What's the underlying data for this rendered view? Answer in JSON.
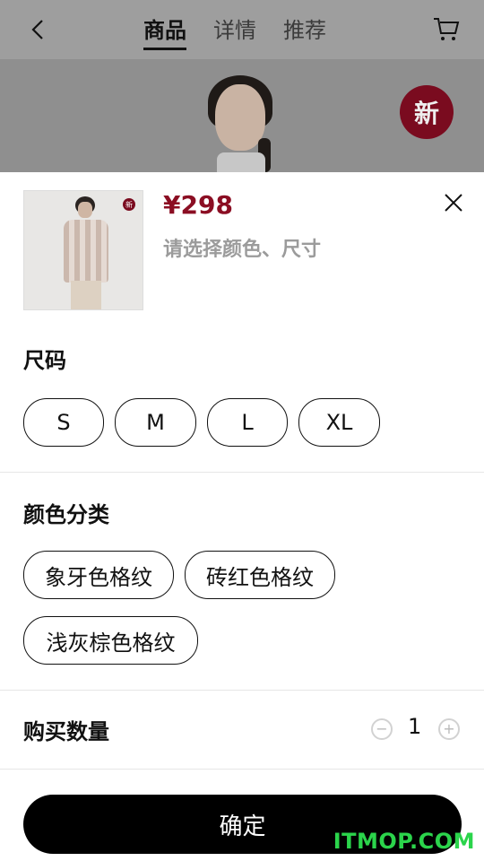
{
  "header": {
    "tabs": [
      {
        "label": "商品",
        "active": true
      },
      {
        "label": "详情",
        "active": false
      },
      {
        "label": "推荐",
        "active": false
      }
    ],
    "icons": {
      "back": "chevron-left-icon",
      "cart": "cart-icon"
    }
  },
  "hero": {
    "badge_text": "新",
    "badge_color": "#7a0b1f"
  },
  "sheet": {
    "price": "¥298",
    "hint": "请选择颜色、尺寸",
    "thumbnail_badge": "新",
    "size_title": "尺码",
    "sizes": [
      "S",
      "M",
      "L",
      "XL"
    ],
    "color_title": "颜色分类",
    "colors": [
      "象牙色格纹",
      "砖红色格纹",
      "浅灰棕色格纹"
    ],
    "quantity_title": "购买数量",
    "quantity": "1",
    "minus": "−",
    "plus": "+",
    "confirm_label": "确定",
    "price_color": "#8b0e23"
  },
  "watermark": "ITMOP.COM"
}
